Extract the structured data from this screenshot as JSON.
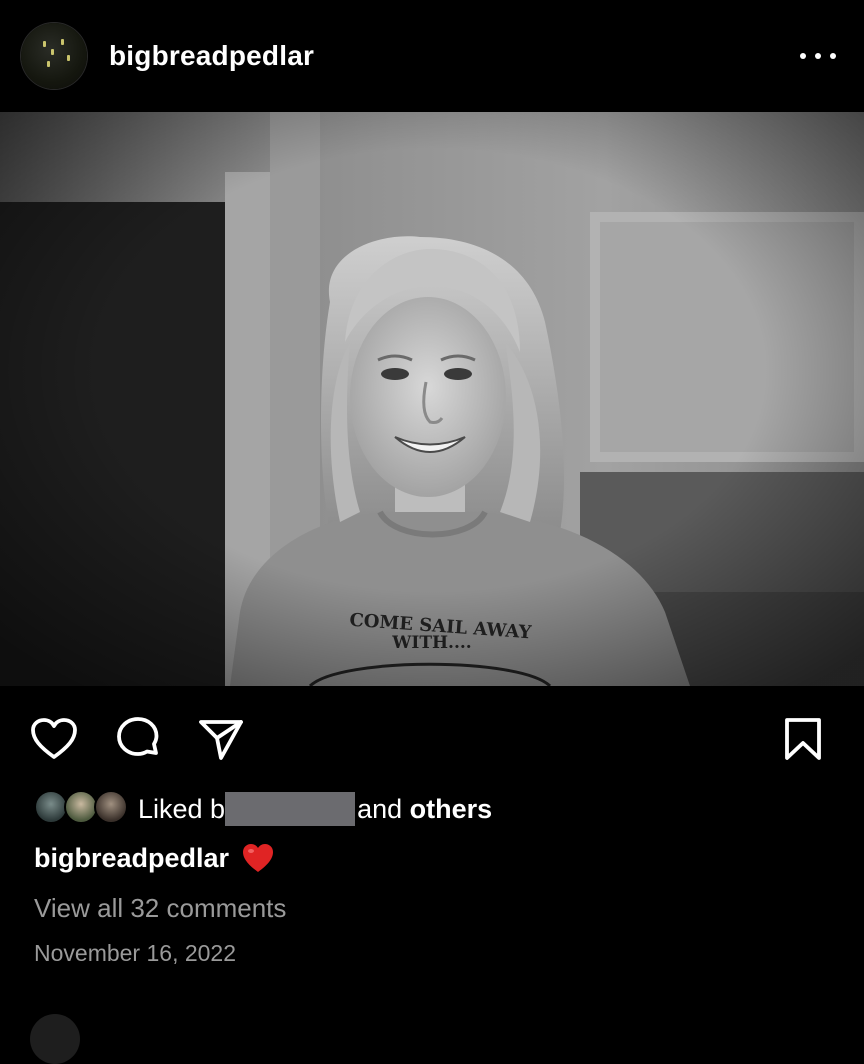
{
  "post": {
    "username": "bigbreadpedlar",
    "avatar_icon": "profile-avatar",
    "more_icon": "more-horizontal-icon"
  },
  "photo": {
    "shirt_line1": "COME SAIL AWAY",
    "shirt_line2": "WITH....",
    "tone": "black-and-white"
  },
  "actions": {
    "like_icon": "heart-outline-icon",
    "comment_icon": "comment-bubble-icon",
    "share_icon": "send-paper-plane-icon",
    "save_icon": "bookmark-outline-icon"
  },
  "likes": {
    "prefix": "Liked b",
    "connector": "and",
    "others": "others"
  },
  "caption": {
    "username": "bigbreadpedlar",
    "emoji": "red-heart-emoji"
  },
  "comments": {
    "view_all": "View all 32 comments"
  },
  "date": "November 16, 2022",
  "colors": {
    "background": "#000000",
    "text": "#ffffff",
    "secondary_text": "#9a9a9a",
    "heart": "#e02424",
    "redaction": "#6b6b6f"
  }
}
